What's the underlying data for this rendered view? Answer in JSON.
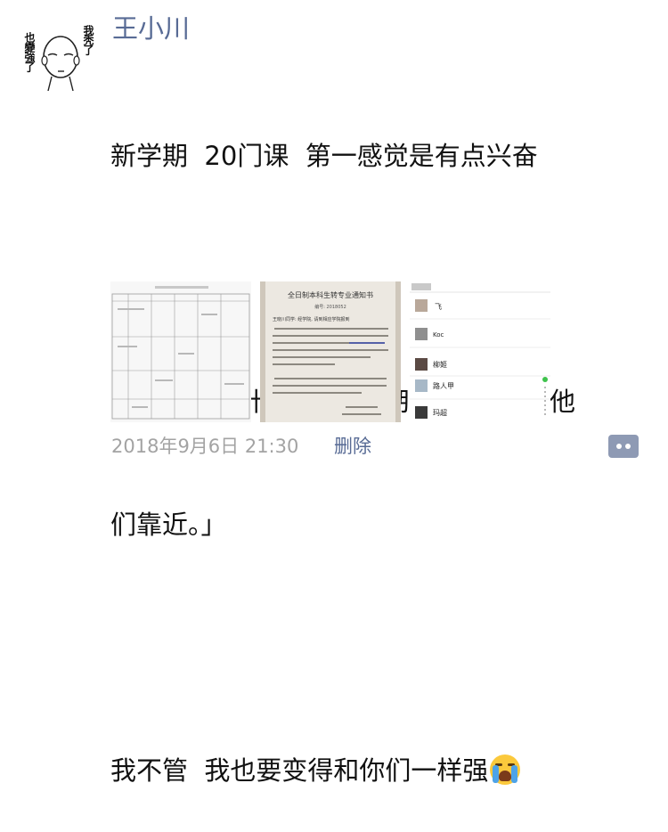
{
  "post": {
    "author": "王小川",
    "avatar_text_left": "也變強了",
    "avatar_text_right": "我秃了",
    "lines": [
      "新学期  20门课  第一感觉是有点兴奋",
      "",
      "「你想成为什么样的人，那就尽量去向他",
      "们靠近。」",
      "",
      "我不管  我也要变得和你们一样强"
    ],
    "emoji": "crying-face-icon",
    "timestamp": "2018年9月6日 21:30",
    "delete_label": "删除"
  },
  "photos": [
    {
      "kind": "timetable-document"
    },
    {
      "kind": "notice-document",
      "title": "全日制本科生转专业通知书",
      "number": "编号: 2018052",
      "greeting": "王晓川同学: 经学院, 请到相应学院报到"
    },
    {
      "kind": "contact-list",
      "contacts": [
        "飞",
        "Koc",
        "柳姬",
        "路人甲",
        "玛超"
      ]
    }
  ],
  "colors": {
    "name": "#586b95",
    "timestamp": "#a3a3a3",
    "comment_button": "#8e9ab4"
  }
}
